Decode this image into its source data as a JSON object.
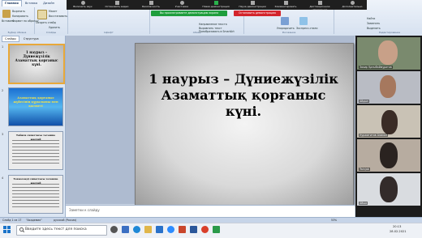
{
  "ribbon": {
    "tabs": [
      "Главная",
      "Вставка",
      "Дизайн"
    ],
    "clipboard": {
      "label": "Буфер обмена",
      "paste": "Вставить",
      "cut": "Вырезать",
      "copy": "Копировать",
      "format": "Формат по образцу"
    },
    "slides": {
      "label": "Слайды",
      "create": "Создать слайд",
      "layout": "Макет",
      "reset": "Восстановить",
      "delete": "Удалить"
    },
    "font": {
      "label": "Шрифт"
    },
    "paragraph": {
      "label": "Абзац",
      "text_dir": "Направление текста",
      "align": "Выровнять текст",
      "smartart": "Преобразовать в SmartArt"
    },
    "drawing": {
      "label": "Рисование",
      "arrange": "Упорядочить",
      "styles": "Экспресс-стили"
    },
    "editing": {
      "label": "Редактирование",
      "find": "Найти",
      "replace": "Заменить",
      "select": "Выделить"
    }
  },
  "zoom": {
    "buttons": [
      "Включить звук",
      "Остановить видео",
      "Безопасность",
      "Участники",
      "Новая демонстрация",
      "Пауза демонстрации",
      "Комментировать",
      "Дистанционное управление",
      "Дополнительно"
    ],
    "green_banner": "Вы просматриваете демонстрацию экрана",
    "red_banner": "Остановить демонстрацию"
  },
  "leftpane": {
    "tabs": [
      "Слайды",
      "Структура"
    ],
    "thumbs": [
      {
        "num": "1",
        "text": "1 наурыз – Дүниежүзілік Азаматтық қорғаныс күні."
      },
      {
        "num": "2",
        "text": "Азаматтық қорғаныс жүйесінің құрылымы мен қызметі"
      },
      {
        "num": "3",
        "text": "Табиғи сипаттағы төтенше жағдай"
      },
      {
        "num": "4",
        "text": "Техногенді сипаттағы төтенше жағдай"
      }
    ]
  },
  "slide": {
    "title": "1 наурыз – Дүниежүзілік Азаматтық қорғаныс күні."
  },
  "notes": {
    "placeholder": "Заметки к слайду"
  },
  "video": {
    "participants": [
      "Закир Қалыбаймұратов",
      "Айдын",
      "Нуржигитов Алихан",
      "Twinjab",
      "Айша"
    ]
  },
  "status": {
    "slide": "Слайд 1 из 17",
    "theme": "\"Академия\"",
    "lang": "русский (Россия)",
    "zoom": "53%"
  },
  "taskbar": {
    "search": "Введите здесь текст для поиска",
    "time": "20:13",
    "date": "28.02.2021"
  }
}
